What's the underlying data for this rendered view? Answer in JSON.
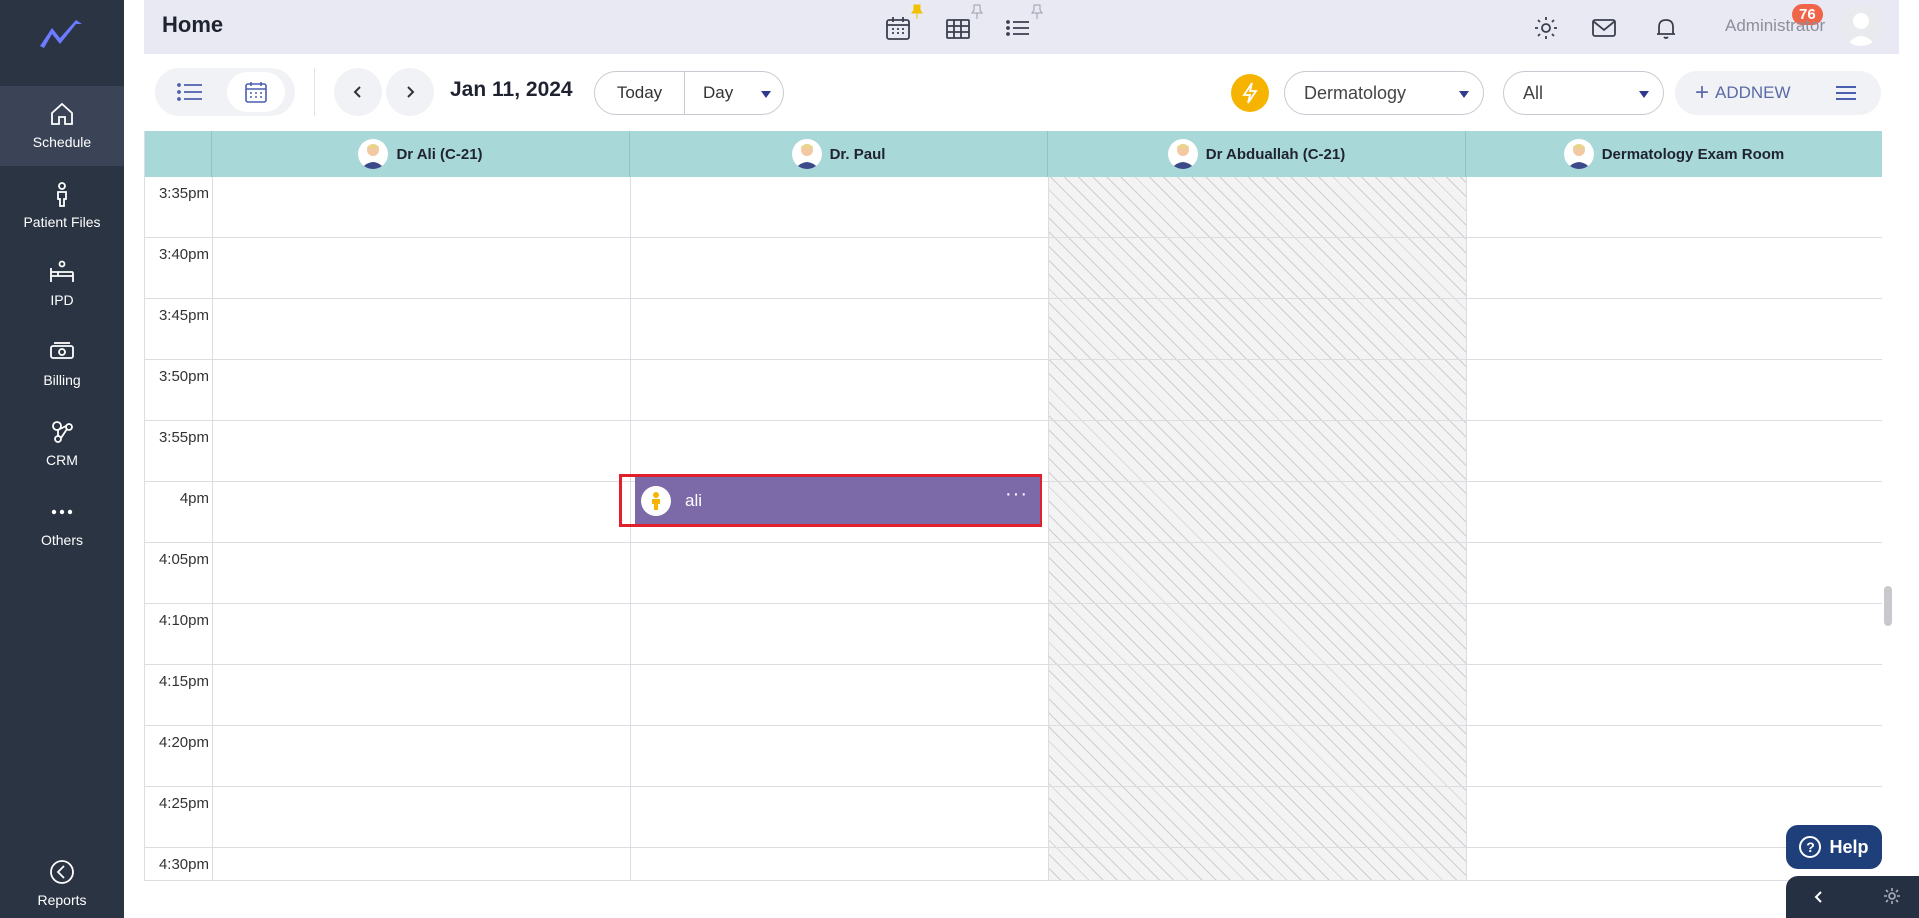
{
  "sidebar": {
    "items": [
      {
        "label": "Schedule"
      },
      {
        "label": "Patient Files"
      },
      {
        "label": "IPD"
      },
      {
        "label": "Billing"
      },
      {
        "label": "CRM"
      },
      {
        "label": "Others"
      }
    ],
    "bottom": {
      "label": "Reports"
    }
  },
  "header": {
    "title": "Home",
    "notifications_count": "76",
    "user_name": "Administrator"
  },
  "toolbar": {
    "date": "Jan 11, 2024",
    "today_label": "Today",
    "view_label": "Day",
    "department": "Dermatology",
    "filter": "All",
    "add_new_label": "ADDNEW"
  },
  "calendar": {
    "columns": [
      {
        "name": "Dr Ali (C-21)"
      },
      {
        "name": "Dr. Paul"
      },
      {
        "name": "Dr Abduallah (C-21)"
      },
      {
        "name": "Dermatology Exam Room"
      }
    ],
    "times": [
      "3:35pm",
      "3:40pm",
      "3:45pm",
      "3:50pm",
      "3:55pm",
      "4pm",
      "4:05pm",
      "4:10pm",
      "4:15pm",
      "4:20pm",
      "4:25pm",
      "4:30pm"
    ],
    "appointment": {
      "patient": "ali",
      "menu_label": "···"
    }
  },
  "help": {
    "label": "Help"
  },
  "colors": {
    "sidebar_bg": "#2b3443",
    "header_bg": "#e8e9f2",
    "column_header_bg": "#a9d8d9",
    "appointment_bg": "#7b69a8",
    "highlight_border": "#e0202d",
    "accent_bolt": "#f6b400",
    "badge_bg": "#f0644a",
    "help_bg": "#1e3f7a"
  }
}
